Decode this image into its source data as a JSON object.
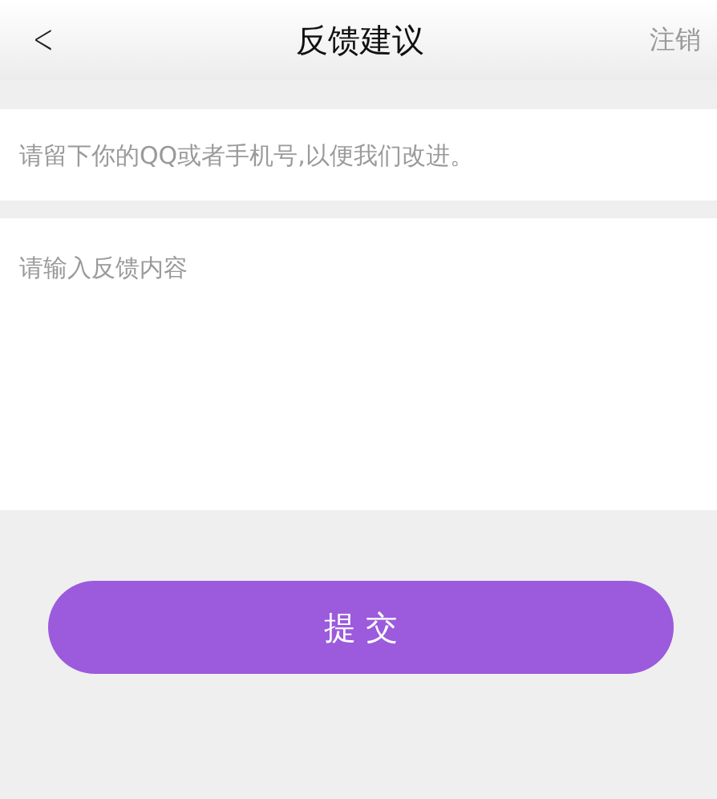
{
  "header": {
    "back": "<",
    "title": "反馈建议",
    "action": "注销"
  },
  "contact": {
    "placeholder": "请留下你的QQ或者手机号,以便我们改进。"
  },
  "feedback": {
    "placeholder": "请输入反馈内容"
  },
  "submit": "提 交"
}
